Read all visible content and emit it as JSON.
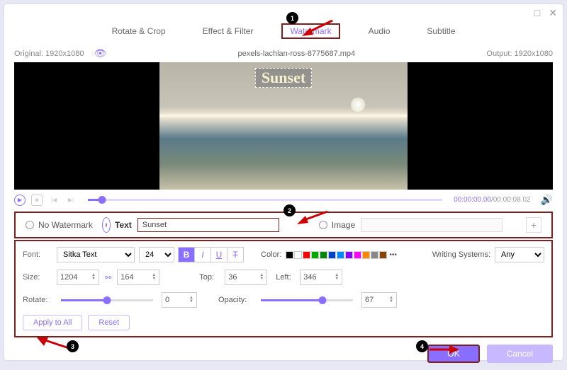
{
  "titlebar": {
    "max": "□",
    "close": "✕"
  },
  "tabs": [
    "Rotate & Crop",
    "Effect & Filter",
    "Watermark",
    "Audio",
    "Subtitle"
  ],
  "active_tab_index": 2,
  "info": {
    "original_label": "Original: 1920x1080",
    "filename": "pexels-lachlan-ross-8775687.mp4",
    "output_label": "Output: 1920x1080"
  },
  "watermark_text": "Sunset",
  "time": {
    "current": "00:00:00.00",
    "total": "00:00:08.02"
  },
  "options": {
    "none": "No Watermark",
    "text": "Text",
    "text_value": "Sunset",
    "image": "Image",
    "image_value": ""
  },
  "props": {
    "font_label": "Font:",
    "font_value": "Sitka Text",
    "font_size": "24",
    "color_label": "Color:",
    "colors": [
      "#000",
      "#fff",
      "#f00",
      "#0a0",
      "#080",
      "#04c",
      "#08f",
      "#80f",
      "#f0f",
      "#f80",
      "#888",
      "#840"
    ],
    "ws_label": "Writing Systems:",
    "ws_value": "Any",
    "size_label": "Size:",
    "size_w": "1204",
    "size_h": "164",
    "top_label": "Top:",
    "top_value": "36",
    "left_label": "Left:",
    "left_value": "346",
    "rotate_label": "Rotate:",
    "rotate_value": "0",
    "rotate_pct": 50,
    "opacity_label": "Opacity:",
    "opacity_value": "67",
    "opacity_pct": 67
  },
  "buttons": {
    "apply": "Apply to All",
    "reset": "Reset",
    "ok": "OK",
    "cancel": "Cancel"
  },
  "callouts": [
    "1",
    "2",
    "3",
    "4"
  ]
}
